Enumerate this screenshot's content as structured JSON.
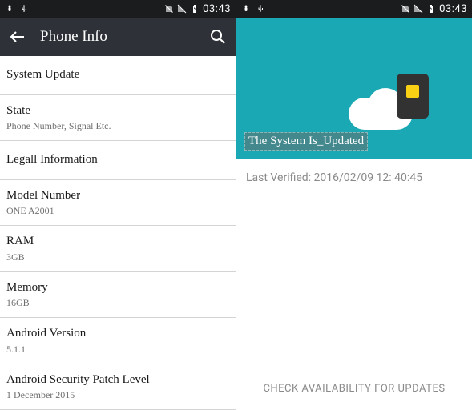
{
  "status": {
    "time": "03:43"
  },
  "left": {
    "title": "Phone Info",
    "items": [
      {
        "primary": "System Update",
        "secondary": null
      },
      {
        "primary": "State",
        "secondary": "Phone Number, Signal Etc."
      },
      {
        "primary": "Legall Information",
        "secondary": null
      },
      {
        "primary": "Model Number",
        "secondary": "ONE A2001"
      },
      {
        "primary": "RAM",
        "secondary": "3GB"
      },
      {
        "primary": "Memory",
        "secondary": "16GB"
      },
      {
        "primary": "Android Version",
        "secondary": "5.1.1"
      },
      {
        "primary": "Android Security Patch Level",
        "secondary": "1 December 2015"
      }
    ]
  },
  "right": {
    "hero_text": "The System Is_Updated",
    "last_verified": "Last Verified: 2016/02/09 12: 40:45",
    "check_button": "CHECK AVAILABILITY FOR UPDATES"
  },
  "colors": {
    "statusbar": "#1b1c1e",
    "appbar": "#2e3238",
    "hero": "#1aa8b4"
  }
}
